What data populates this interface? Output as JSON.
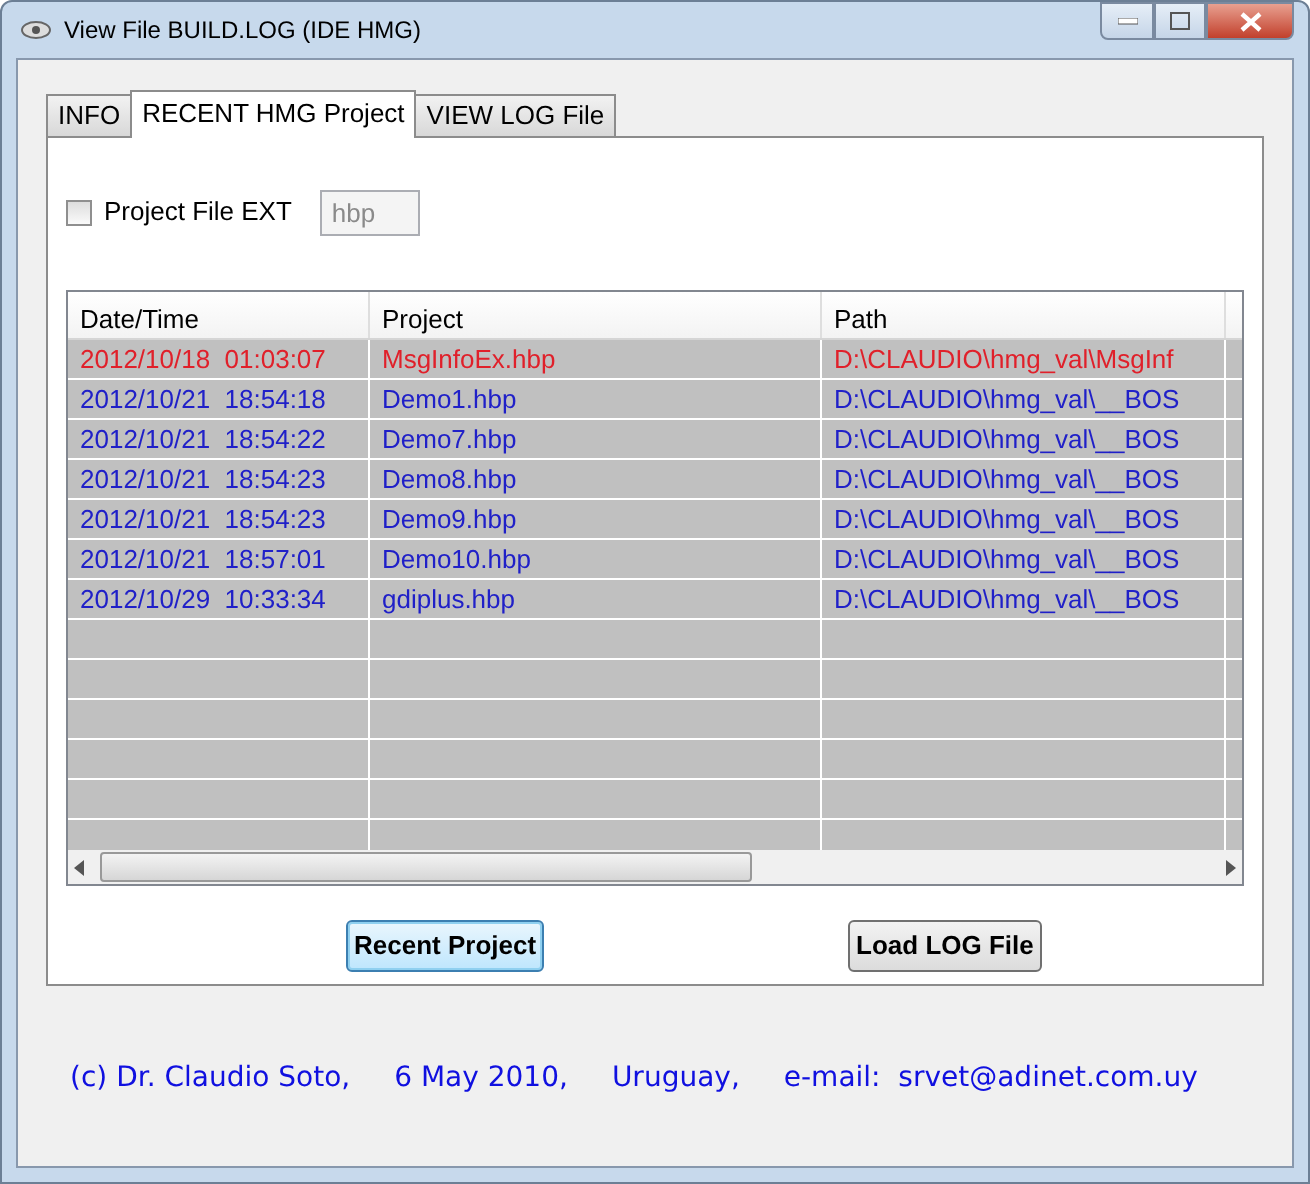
{
  "window": {
    "title": "View File BUILD.LOG (IDE HMG)"
  },
  "tabs": [
    {
      "label": "INFO",
      "selected": false
    },
    {
      "label": "RECENT HMG Project",
      "selected": true
    },
    {
      "label": "VIEW LOG File",
      "selected": false
    }
  ],
  "project_ext": {
    "label": "Project File EXT",
    "checked": false,
    "value": "hbp",
    "disabled": true
  },
  "table": {
    "columns": [
      "Date/Time",
      "Project",
      "Path"
    ],
    "rows": [
      {
        "cells": [
          "2012/10/18  01:03:07",
          "MsgInfoEx.hbp",
          "D:\\CLAUDIO\\hmg_val\\MsgInf"
        ],
        "color": "#e0202a"
      },
      {
        "cells": [
          "2012/10/21  18:54:18",
          "Demo1.hbp",
          "D:\\CLAUDIO\\hmg_val\\__BOS"
        ],
        "color": "#2020c8"
      },
      {
        "cells": [
          "2012/10/21  18:54:22",
          "Demo7.hbp",
          "D:\\CLAUDIO\\hmg_val\\__BOS"
        ],
        "color": "#2020c8"
      },
      {
        "cells": [
          "2012/10/21  18:54:23",
          "Demo8.hbp",
          "D:\\CLAUDIO\\hmg_val\\__BOS"
        ],
        "color": "#2020c8"
      },
      {
        "cells": [
          "2012/10/21  18:54:23",
          "Demo9.hbp",
          "D:\\CLAUDIO\\hmg_val\\__BOS"
        ],
        "color": "#2020c8"
      },
      {
        "cells": [
          "2012/10/21  18:57:01",
          "Demo10.hbp",
          "D:\\CLAUDIO\\hmg_val\\__BOS"
        ],
        "color": "#2020c8"
      },
      {
        "cells": [
          "2012/10/29  10:33:34",
          "gdiplus.hbp",
          "D:\\CLAUDIO\\hmg_val\\__BOS"
        ],
        "color": "#2020c8"
      }
    ]
  },
  "buttons": [
    {
      "label": "Recent Project",
      "focused": true
    },
    {
      "label": "Load LOG File",
      "focused": false
    }
  ],
  "footer": [
    "(c) Dr. Claudio Soto,",
    "6 May 2010,",
    "Uruguay,",
    "e-mail:  srvet@adinet.com.uy"
  ]
}
